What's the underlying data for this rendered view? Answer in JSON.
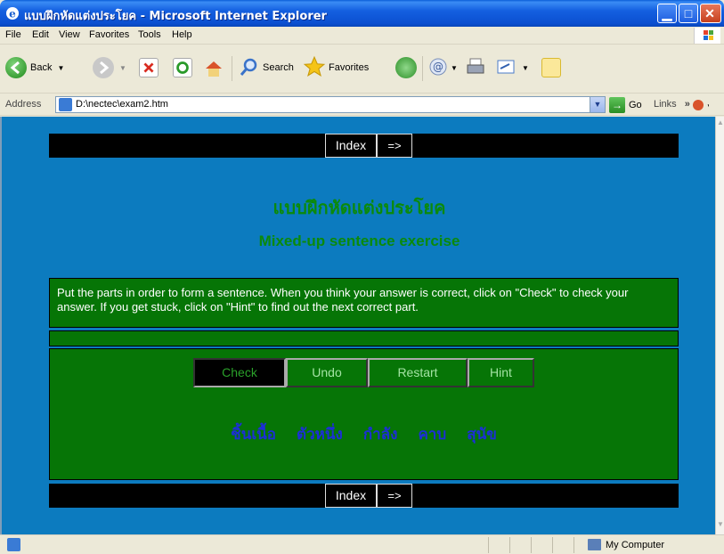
{
  "window": {
    "title": "แบบฝึกหัดแต่งประโยค - Microsoft Internet Explorer"
  },
  "menu": [
    "File",
    "Edit",
    "View",
    "Favorites",
    "Tools",
    "Help"
  ],
  "toolbar": {
    "back": "Back",
    "search": "Search",
    "favorites": "Favorites"
  },
  "address": {
    "label": "Address",
    "url": "D:\\nectec\\exam2.htm",
    "go": "Go",
    "links": "Links",
    "links_more": "»"
  },
  "page": {
    "nav": {
      "index": "Index",
      "next": "=>"
    },
    "title_th": "แบบฝึกหัดแต่งประโยค",
    "title_en": "Mixed-up sentence exercise",
    "instructions": "Put the parts in order to form a sentence. When you think your answer is correct, click on \"Check\" to check your answer. If you get stuck, click on \"Hint\" to find out the next correct part.",
    "buttons": {
      "check": "Check",
      "undo": "Undo",
      "restart": "Restart",
      "hint": "Hint"
    },
    "words": [
      "ชิ้นเนื้อ",
      "ตัวหนึ่ง",
      "กำลัง",
      "คาบ",
      "สุนัข"
    ]
  },
  "status": {
    "zone": "My Computer"
  },
  "colors": {
    "page_bg": "#0c7bbf",
    "panel_green": "#067506",
    "heading_green": "#0b8a0b",
    "word_blue": "#1c2fd6"
  }
}
